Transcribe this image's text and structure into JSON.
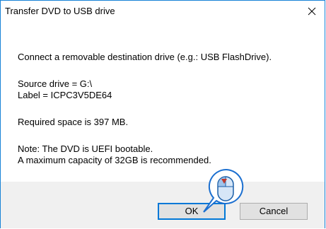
{
  "window": {
    "title": "Transfer DVD to USB drive"
  },
  "content": {
    "line1": "Connect a removable destination drive (e.g.: USB FlashDrive).",
    "line2": "Source drive = G:\\",
    "line3": "Label = ICPC3V5DE64",
    "line4": "Required space is 397 MB.",
    "line5": "Note: The DVD is UEFI bootable.",
    "line6": "A maximum capacity of 32GB is recommended."
  },
  "buttons": {
    "ok_label": "OK",
    "cancel_label": "Cancel"
  },
  "icons": {
    "close": "close-icon",
    "mouse": "mouse-click-icon"
  },
  "colors": {
    "accent": "#0078d7",
    "border": "#1883d7",
    "footer_bg": "#f0f0f0"
  }
}
